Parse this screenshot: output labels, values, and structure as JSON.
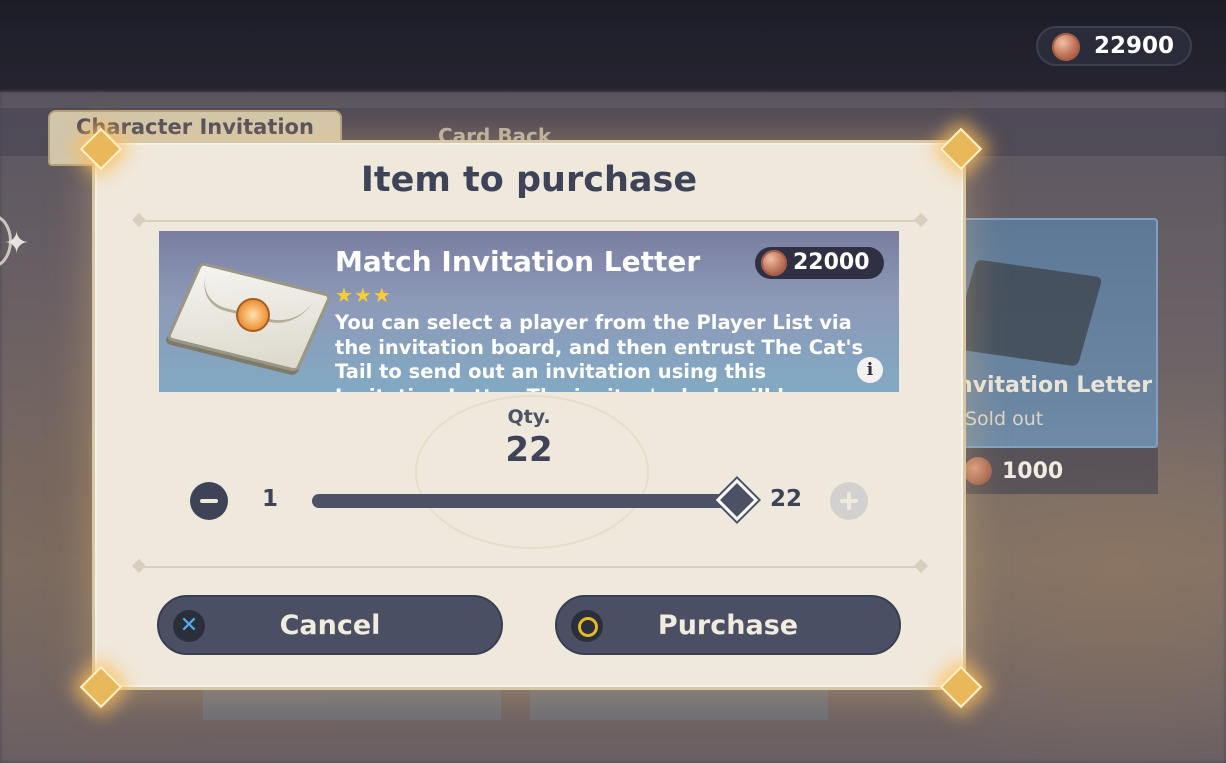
{
  "currency": {
    "amount": "22900"
  },
  "background": {
    "tabs": [
      "Character Invitation",
      "Card Back"
    ],
    "card": {
      "title": "nvitation Letter",
      "status": "Sold out",
      "price": "1000"
    }
  },
  "dialog": {
    "title": "Item to purchase",
    "item": {
      "name": "Match Invitation Letter",
      "stars": "★★★",
      "price": "22000",
      "description": "You can select a player from the Player List via the invitation board, and then entrust The Cat's Tail to send out an invitation using this Invitation Letter. The invitee's deck will be adapted..."
    },
    "quantity": {
      "label": "Qty.",
      "value": "22",
      "min": "1",
      "max": "22",
      "fill_fraction": 1.0
    },
    "buttons": {
      "cancel": "Cancel",
      "purchase": "Purchase",
      "cancel_icon": "✕"
    }
  }
}
